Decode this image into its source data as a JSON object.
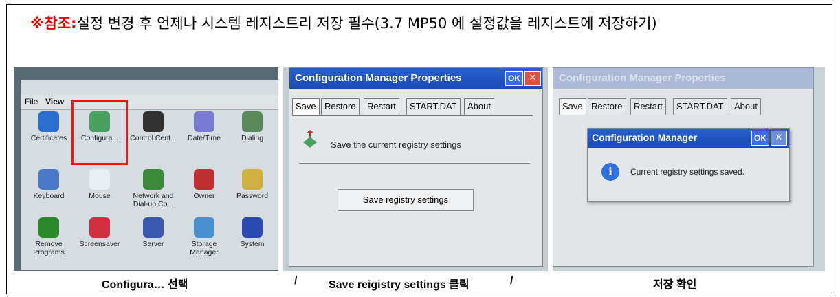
{
  "note": {
    "marker": "※",
    "label": "참조:",
    "text": "설정 변경 후 언제나 시스템 레지스트리 저장 필수(3.7 MP50 에 설정값을 레지스트에 저장하기)"
  },
  "panel1": {
    "menu": [
      "File",
      "View"
    ],
    "items": [
      {
        "label": "Certificates",
        "icon": "certificates-icon",
        "color": "#2a6fd0"
      },
      {
        "label": "Configura...",
        "icon": "configuration-manager-icon",
        "color": "#4aa060"
      },
      {
        "label": "Control Cent...",
        "icon": "control-center-icon",
        "color": "#333333"
      },
      {
        "label": "Date/Time",
        "icon": "clock-icon",
        "color": "#7a7ad0"
      },
      {
        "label": "Dialing",
        "icon": "phone-icon",
        "color": "#5a8a5a"
      },
      {
        "label": "Keyboard",
        "icon": "keyboard-icon",
        "color": "#4a7ac8"
      },
      {
        "label": "Mouse",
        "icon": "mouse-icon",
        "color": "#e8eef2"
      },
      {
        "label": "Network and Dial-up Co...",
        "icon": "network-icon",
        "color": "#3a8a3a"
      },
      {
        "label": "Owner",
        "icon": "owner-icon",
        "color": "#c03030"
      },
      {
        "label": "Password",
        "icon": "password-icon",
        "color": "#d0b040"
      },
      {
        "label": "Remove Programs",
        "icon": "remove-programs-icon",
        "color": "#2a8a2a"
      },
      {
        "label": "Screensaver",
        "icon": "screensaver-icon",
        "color": "#d03040"
      },
      {
        "label": "Server",
        "icon": "server-icon",
        "color": "#3a5ab0"
      },
      {
        "label": "Storage Manager",
        "icon": "storage-icon",
        "color": "#4a90d0"
      },
      {
        "label": "System",
        "icon": "system-icon",
        "color": "#2a4ab0"
      }
    ]
  },
  "panel2": {
    "title": "Configuration Manager Properties",
    "ok": "OK",
    "close": "✕",
    "tabs": [
      "Save",
      "Restore",
      "Restart",
      "START.DAT",
      "About"
    ],
    "description": "Save the current registry settings",
    "button": "Save registry settings"
  },
  "panel3": {
    "title": "Configuration Manager Properties",
    "tabs": [
      "Save",
      "Restore",
      "Restart",
      "START.DAT",
      "About"
    ],
    "popup_title": "Configuration Manager",
    "ok": "OK",
    "close": "✕",
    "message": "Current registry settings saved."
  },
  "captions": {
    "c1": "Configura… 선택",
    "sep1": "/",
    "c2": "Save reigistry settings 클릭",
    "sep2": "/",
    "c3": "저장 확인"
  }
}
